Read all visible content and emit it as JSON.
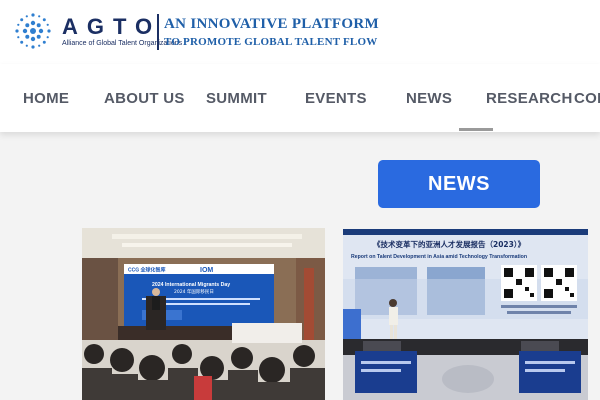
{
  "header": {
    "logo_text": "AGTO",
    "logo_subtitle": "Alliance of Global Talent Organizations",
    "tagline_line1": "AN INNOVATIVE PLATFORM",
    "tagline_line2": "TO PROMOTE GLOBAL TALENT FLOW"
  },
  "nav": {
    "items": [
      {
        "label": "HOME"
      },
      {
        "label": "ABOUT US"
      },
      {
        "label": "SUMMIT"
      },
      {
        "label": "EVENTS"
      },
      {
        "label": "NEWS"
      },
      {
        "label": "RESEARCH"
      },
      {
        "label": "CON"
      }
    ],
    "active_item": "RESEARCH"
  },
  "section": {
    "news_button_label": "NEWS"
  },
  "photos": {
    "photo1": {
      "screen_title_line1": "2024 International Migrants Day",
      "screen_title_line2": "2024 年国际移民日",
      "brand_cco": "CCG 全球化智库",
      "brand_iom": "IOM"
    },
    "photo2": {
      "screen_title_zh": "《技术变革下的亚洲人才发展报告（2023）》",
      "screen_title_en": "Report on Talent Development in Asia amid Technology Transformation"
    }
  },
  "colors": {
    "brand_navy": "#1b2f63",
    "tagline_blue": "#1f5fa8",
    "button_blue": "#2a6ae0",
    "nav_text": "#555a66"
  }
}
